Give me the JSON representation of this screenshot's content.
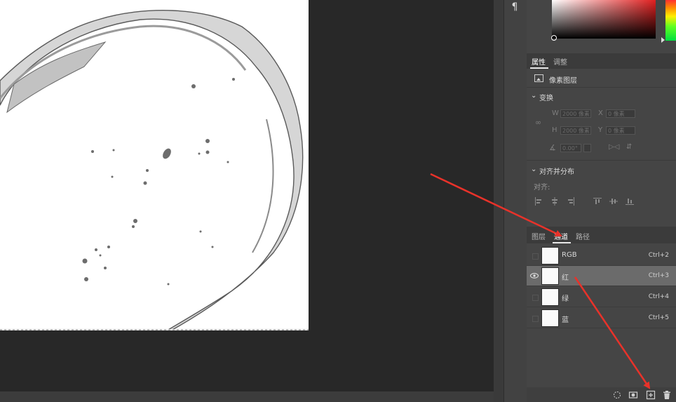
{
  "panel_toolbar": {
    "paragraph_icon": "¶"
  },
  "properties": {
    "tabs": [
      {
        "label": "属性"
      },
      {
        "label": "调整"
      }
    ],
    "layer_kind": "像素图层",
    "transform": {
      "title": "变换",
      "w_label": "W",
      "w_value": "2000 像素",
      "h_label": "H",
      "h_value": "2000 像素",
      "x_label": "X",
      "x_value": "0 像素",
      "y_label": "Y",
      "y_value": "0 像素",
      "angle_value": "0.00°"
    },
    "align": {
      "title": "对齐并分布",
      "align_label": "对齐:"
    }
  },
  "channels": {
    "tabs": [
      {
        "label": "图层"
      },
      {
        "label": "通道"
      },
      {
        "label": "路径"
      }
    ],
    "rows": [
      {
        "name": "RGB",
        "shortcut": "Ctrl+2"
      },
      {
        "name": "红",
        "shortcut": "Ctrl+3"
      },
      {
        "name": "绿",
        "shortcut": "Ctrl+4"
      },
      {
        "name": "蓝",
        "shortcut": "Ctrl+5"
      }
    ],
    "footer_icons": [
      "load-selection-icon",
      "save-selection-icon",
      "new-channel-icon",
      "delete-channel-icon"
    ]
  },
  "colors": {
    "annotation_arrow": "#e8322a",
    "selected_row": "#6b6b6b",
    "panel_bg": "#454545"
  }
}
